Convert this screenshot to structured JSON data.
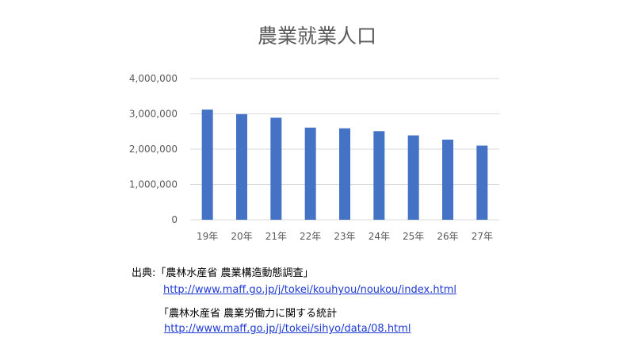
{
  "chart_data": {
    "type": "bar",
    "title": "農業就業人口",
    "categories": [
      "19年",
      "20年",
      "21年",
      "22年",
      "23年",
      "24年",
      "25年",
      "26年",
      "27年"
    ],
    "values": [
      3120000,
      2990000,
      2890000,
      2610000,
      2590000,
      2510000,
      2390000,
      2270000,
      2100000
    ],
    "ylim": [
      0,
      4000000
    ],
    "yticks": [
      "0",
      "1,000,000",
      "2,000,000",
      "3,000,000",
      "4,000,000"
    ],
    "ytick_values": [
      0,
      1000000,
      2000000,
      3000000,
      4000000
    ],
    "grid": true,
    "bar_color": "#4472c4",
    "grid_color": "#d9d9d9"
  },
  "sources": {
    "line1_label": "出典:「農林水産省 農業構造動態調査」",
    "line1_url": "http://www.maff.go.jp/j/tokei/kouhyou/noukou/index.html",
    "line2_label": "「農林水産省 農業労働力に関する統計",
    "line2_url": "http://www.maff.go.jp/j/tokei/sihyo/data/08.html"
  }
}
